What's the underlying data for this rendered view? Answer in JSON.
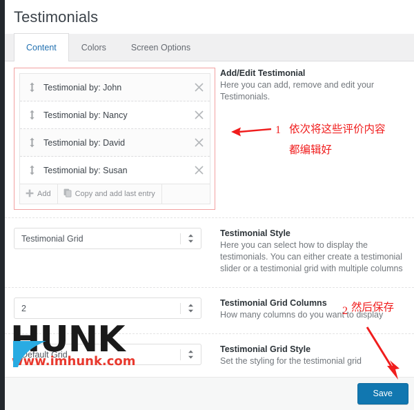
{
  "header": {
    "title": "Testimonials"
  },
  "tabs": [
    {
      "label": "Content",
      "active": true
    },
    {
      "label": "Colors",
      "active": false
    },
    {
      "label": "Screen Options",
      "active": false
    }
  ],
  "testimonial_list": {
    "items": [
      {
        "label": "Testimonial by: John"
      },
      {
        "label": "Testimonial by: Nancy"
      },
      {
        "label": "Testimonial by: David"
      },
      {
        "label": "Testimonial by: Susan"
      }
    ],
    "add_label": "Add",
    "copy_label": "Copy and add last entry",
    "highlight_color": "#f2a0a0"
  },
  "sections": {
    "add_edit": {
      "title": "Add/Edit Testimonial",
      "desc": "Here you can add, remove and edit your Testimonials."
    },
    "style": {
      "title": "Testimonial Style",
      "desc": "Here you can select how to display the testimonials. You can either create a testimonial slider or a testimonial grid with multiple columns",
      "value": "Testimonial Grid"
    },
    "columns": {
      "title": "Testimonial Grid Columns",
      "desc": "How many columns do you want to display",
      "value": "2"
    },
    "grid_style": {
      "title": "Testimonial Grid Style",
      "desc": "Set the styling for the testimonial grid",
      "value": "Default Grid"
    }
  },
  "footer": {
    "save_label": "Save",
    "save_color": "#1177b0"
  },
  "annotations": [
    {
      "num": "1",
      "line1": "依次将这些评价内容",
      "line2": "都编辑好",
      "color": "#f01d1d"
    },
    {
      "num": "2",
      "line1": "然后保存",
      "color": "#f01d1d"
    }
  ],
  "watermark": {
    "brand": "HUNK",
    "url": "www.imhunk.com",
    "brand_color": "#1a1a1a",
    "url_color": "#e8392e"
  }
}
